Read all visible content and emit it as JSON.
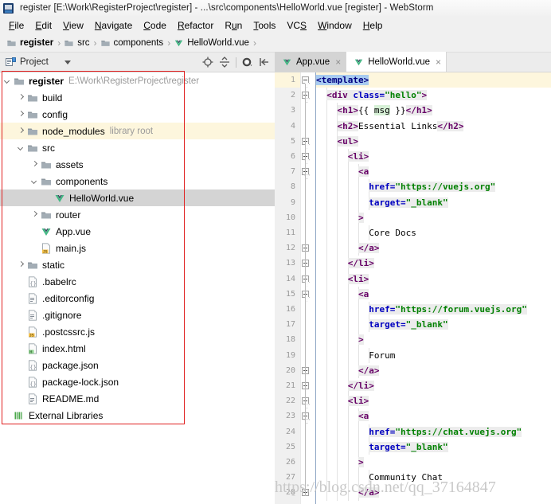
{
  "window": {
    "title": "register [E:\\Work\\RegisterProject\\register] - ...\\src\\components\\HelloWorld.vue [register] - WebStorm",
    "icon": "webstorm-icon"
  },
  "menubar": {
    "items": [
      {
        "label": "File",
        "mnemonic": "F"
      },
      {
        "label": "Edit",
        "mnemonic": "E"
      },
      {
        "label": "View",
        "mnemonic": "V"
      },
      {
        "label": "Navigate",
        "mnemonic": "N"
      },
      {
        "label": "Code",
        "mnemonic": "C"
      },
      {
        "label": "Refactor",
        "mnemonic": "R"
      },
      {
        "label": "Run",
        "mnemonic": "u"
      },
      {
        "label": "Tools",
        "mnemonic": "T"
      },
      {
        "label": "VCS",
        "mnemonic": "S"
      },
      {
        "label": "Window",
        "mnemonic": "W"
      },
      {
        "label": "Help",
        "mnemonic": "H"
      }
    ]
  },
  "breadcrumb": {
    "items": [
      {
        "label": "register",
        "icon": "folder-icon",
        "bold": true
      },
      {
        "label": "src",
        "icon": "folder-icon",
        "bold": false
      },
      {
        "label": "components",
        "icon": "folder-icon",
        "bold": false
      },
      {
        "label": "HelloWorld.vue",
        "icon": "vue-icon",
        "bold": false
      }
    ],
    "separator": "›"
  },
  "toolwindow": {
    "title": "Project",
    "icon": "project-icon",
    "actions": [
      {
        "name": "locate-icon"
      },
      {
        "name": "collapse-all-icon"
      },
      {
        "name": "settings-gear-icon"
      },
      {
        "name": "hide-icon"
      }
    ]
  },
  "editor_tabs": [
    {
      "label": "App.vue",
      "icon": "vue-icon",
      "active": false,
      "close": "×"
    },
    {
      "label": "HelloWorld.vue",
      "icon": "vue-icon",
      "active": true,
      "close": "×"
    }
  ],
  "tree": {
    "rows": [
      {
        "indent": 0,
        "arrow": "down",
        "icon": "folder-icon",
        "label": "register",
        "bold": true,
        "path": "E:\\Work\\RegisterProject\\register",
        "state": "normal"
      },
      {
        "indent": 1,
        "arrow": "right",
        "icon": "folder-icon",
        "label": "build",
        "bold": false,
        "path": "",
        "state": "normal"
      },
      {
        "indent": 1,
        "arrow": "right",
        "icon": "folder-icon",
        "label": "config",
        "bold": false,
        "path": "",
        "state": "normal"
      },
      {
        "indent": 1,
        "arrow": "right",
        "icon": "folder-icon",
        "label": "node_modules",
        "bold": false,
        "path": "library root",
        "state": "highlight"
      },
      {
        "indent": 1,
        "arrow": "down",
        "icon": "folder-icon",
        "label": "src",
        "bold": false,
        "path": "",
        "state": "normal"
      },
      {
        "indent": 2,
        "arrow": "right",
        "icon": "folder-icon",
        "label": "assets",
        "bold": false,
        "path": "",
        "state": "normal"
      },
      {
        "indent": 2,
        "arrow": "down",
        "icon": "folder-icon",
        "label": "components",
        "bold": false,
        "path": "",
        "state": "normal"
      },
      {
        "indent": 3,
        "arrow": "none",
        "icon": "vue-icon",
        "label": "HelloWorld.vue",
        "bold": false,
        "path": "",
        "state": "selected"
      },
      {
        "indent": 2,
        "arrow": "right",
        "icon": "folder-icon",
        "label": "router",
        "bold": false,
        "path": "",
        "state": "normal"
      },
      {
        "indent": 2,
        "arrow": "none",
        "icon": "vue-icon",
        "label": "App.vue",
        "bold": false,
        "path": "",
        "state": "normal"
      },
      {
        "indent": 2,
        "arrow": "none",
        "icon": "js-file-icon",
        "label": "main.js",
        "bold": false,
        "path": "",
        "state": "normal"
      },
      {
        "indent": 1,
        "arrow": "right",
        "icon": "folder-icon",
        "label": "static",
        "bold": false,
        "path": "",
        "state": "normal"
      },
      {
        "indent": 1,
        "arrow": "none",
        "icon": "json-file-icon",
        "label": ".babelrc",
        "bold": false,
        "path": "",
        "state": "normal"
      },
      {
        "indent": 1,
        "arrow": "none",
        "icon": "text-file-icon",
        "label": ".editorconfig",
        "bold": false,
        "path": "",
        "state": "normal"
      },
      {
        "indent": 1,
        "arrow": "none",
        "icon": "text-file-icon",
        "label": ".gitignore",
        "bold": false,
        "path": "",
        "state": "normal"
      },
      {
        "indent": 1,
        "arrow": "none",
        "icon": "js-file-icon",
        "label": ".postcssrc.js",
        "bold": false,
        "path": "",
        "state": "normal"
      },
      {
        "indent": 1,
        "arrow": "none",
        "icon": "html-file-icon",
        "label": "index.html",
        "bold": false,
        "path": "",
        "state": "normal"
      },
      {
        "indent": 1,
        "arrow": "none",
        "icon": "json-file-icon",
        "label": "package.json",
        "bold": false,
        "path": "",
        "state": "normal"
      },
      {
        "indent": 1,
        "arrow": "none",
        "icon": "json-file-icon",
        "label": "package-lock.json",
        "bold": false,
        "path": "",
        "state": "normal"
      },
      {
        "indent": 1,
        "arrow": "none",
        "icon": "text-file-icon",
        "label": "README.md",
        "bold": false,
        "path": "",
        "state": "normal"
      },
      {
        "indent": 0,
        "arrow": "none",
        "icon": "external-libraries-icon",
        "label": "External Libraries",
        "bold": false,
        "path": "",
        "state": "normal"
      }
    ]
  },
  "editor": {
    "language": "vue",
    "current_line": 1,
    "selection_text": "<template>",
    "lines": [
      {
        "n": 1,
        "indent": 0,
        "fold": "start",
        "tokens": [
          {
            "t": "<template>",
            "c": "tag",
            "bg": "sel"
          }
        ]
      },
      {
        "n": 2,
        "indent": 1,
        "fold": "start",
        "tokens": [
          {
            "t": "<div",
            "c": "tagp",
            "bg": "tag"
          },
          {
            "t": " ",
            "c": "txt",
            "bg": "tag"
          },
          {
            "t": "class=",
            "c": "attr",
            "bg": "tag"
          },
          {
            "t": "\"hello\"",
            "c": "val",
            "bg": "tag"
          },
          {
            "t": ">",
            "c": "tagp",
            "bg": "tag"
          }
        ]
      },
      {
        "n": 3,
        "indent": 2,
        "fold": "none",
        "tokens": [
          {
            "t": "<h1>",
            "c": "tagp",
            "bg": "tag"
          },
          {
            "t": "{{ ",
            "c": "txt",
            "bg": "none"
          },
          {
            "t": "msg",
            "c": "txt",
            "bg": "msg"
          },
          {
            "t": " }}",
            "c": "txt",
            "bg": "none"
          },
          {
            "t": "</h1>",
            "c": "tagp",
            "bg": "tag"
          }
        ]
      },
      {
        "n": 4,
        "indent": 2,
        "fold": "none",
        "tokens": [
          {
            "t": "<h2>",
            "c": "tagp",
            "bg": "tag"
          },
          {
            "t": "Essential Links",
            "c": "txt",
            "bg": "none"
          },
          {
            "t": "</h2>",
            "c": "tagp",
            "bg": "tag"
          }
        ]
      },
      {
        "n": 5,
        "indent": 2,
        "fold": "start",
        "tokens": [
          {
            "t": "<ul>",
            "c": "tagp",
            "bg": "tag"
          }
        ]
      },
      {
        "n": 6,
        "indent": 3,
        "fold": "start",
        "tokens": [
          {
            "t": "<li>",
            "c": "tagp",
            "bg": "tag"
          }
        ]
      },
      {
        "n": 7,
        "indent": 4,
        "fold": "start",
        "tokens": [
          {
            "t": "<a",
            "c": "tagp",
            "bg": "tag"
          }
        ]
      },
      {
        "n": 8,
        "indent": 5,
        "fold": "none",
        "tokens": [
          {
            "t": "href=",
            "c": "attr",
            "bg": "tag"
          },
          {
            "t": "\"https://vuejs.org\"",
            "c": "val",
            "bg": "tag"
          }
        ]
      },
      {
        "n": 9,
        "indent": 5,
        "fold": "none",
        "tokens": [
          {
            "t": "target=",
            "c": "attr",
            "bg": "tag"
          },
          {
            "t": "\"_blank\"",
            "c": "val",
            "bg": "tag"
          }
        ]
      },
      {
        "n": 10,
        "indent": 4,
        "fold": "none",
        "tokens": [
          {
            "t": ">",
            "c": "tagp",
            "bg": "tag"
          }
        ]
      },
      {
        "n": 11,
        "indent": 5,
        "fold": "none",
        "tokens": [
          {
            "t": "Core Docs",
            "c": "txt",
            "bg": "none"
          }
        ]
      },
      {
        "n": 12,
        "indent": 4,
        "fold": "end",
        "tokens": [
          {
            "t": "</a>",
            "c": "tagp",
            "bg": "tag"
          }
        ]
      },
      {
        "n": 13,
        "indent": 3,
        "fold": "end",
        "tokens": [
          {
            "t": "</li>",
            "c": "tagp",
            "bg": "tag"
          }
        ]
      },
      {
        "n": 14,
        "indent": 3,
        "fold": "start",
        "tokens": [
          {
            "t": "<li>",
            "c": "tagp",
            "bg": "tag"
          }
        ]
      },
      {
        "n": 15,
        "indent": 4,
        "fold": "start",
        "tokens": [
          {
            "t": "<a",
            "c": "tagp",
            "bg": "tag"
          }
        ]
      },
      {
        "n": 16,
        "indent": 5,
        "fold": "none",
        "tokens": [
          {
            "t": "href=",
            "c": "attr",
            "bg": "tag"
          },
          {
            "t": "\"https://forum.vuejs.org\"",
            "c": "val",
            "bg": "tag"
          }
        ]
      },
      {
        "n": 17,
        "indent": 5,
        "fold": "none",
        "tokens": [
          {
            "t": "target=",
            "c": "attr",
            "bg": "tag"
          },
          {
            "t": "\"_blank\"",
            "c": "val",
            "bg": "tag"
          }
        ]
      },
      {
        "n": 18,
        "indent": 4,
        "fold": "none",
        "tokens": [
          {
            "t": ">",
            "c": "tagp",
            "bg": "tag"
          }
        ]
      },
      {
        "n": 19,
        "indent": 5,
        "fold": "none",
        "tokens": [
          {
            "t": "Forum",
            "c": "txt",
            "bg": "none"
          }
        ]
      },
      {
        "n": 20,
        "indent": 4,
        "fold": "end",
        "tokens": [
          {
            "t": "</a>",
            "c": "tagp",
            "bg": "tag"
          }
        ]
      },
      {
        "n": 21,
        "indent": 3,
        "fold": "end",
        "tokens": [
          {
            "t": "</li>",
            "c": "tagp",
            "bg": "tag"
          }
        ]
      },
      {
        "n": 22,
        "indent": 3,
        "fold": "start",
        "tokens": [
          {
            "t": "<li>",
            "c": "tagp",
            "bg": "tag"
          }
        ]
      },
      {
        "n": 23,
        "indent": 4,
        "fold": "start",
        "tokens": [
          {
            "t": "<a",
            "c": "tagp",
            "bg": "tag"
          }
        ]
      },
      {
        "n": 24,
        "indent": 5,
        "fold": "none",
        "tokens": [
          {
            "t": "href=",
            "c": "attr",
            "bg": "tag"
          },
          {
            "t": "\"https://chat.vuejs.org\"",
            "c": "val",
            "bg": "tag"
          }
        ]
      },
      {
        "n": 25,
        "indent": 5,
        "fold": "none",
        "tokens": [
          {
            "t": "target=",
            "c": "attr",
            "bg": "tag"
          },
          {
            "t": "\"_blank\"",
            "c": "val",
            "bg": "tag"
          }
        ]
      },
      {
        "n": 26,
        "indent": 4,
        "fold": "none",
        "tokens": [
          {
            "t": ">",
            "c": "tagp",
            "bg": "tag"
          }
        ]
      },
      {
        "n": 27,
        "indent": 5,
        "fold": "none",
        "tokens": [
          {
            "t": "Community Chat",
            "c": "txt",
            "bg": "none"
          }
        ]
      },
      {
        "n": 28,
        "indent": 4,
        "fold": "end",
        "tokens": [
          {
            "t": "</a>",
            "c": "tagp",
            "bg": "tag"
          }
        ]
      }
    ]
  },
  "watermark": "https://blog.csdn.net/qq_37164847",
  "colors": {
    "tag": "#000080",
    "tag_purple": "#660066",
    "attribute": "#0000c0",
    "value": "#008000",
    "selection": "#a8cbf0",
    "current_line": "#fdf6dd",
    "tree_selection": "#d4d4d4",
    "annotation_box": "#e02020"
  }
}
